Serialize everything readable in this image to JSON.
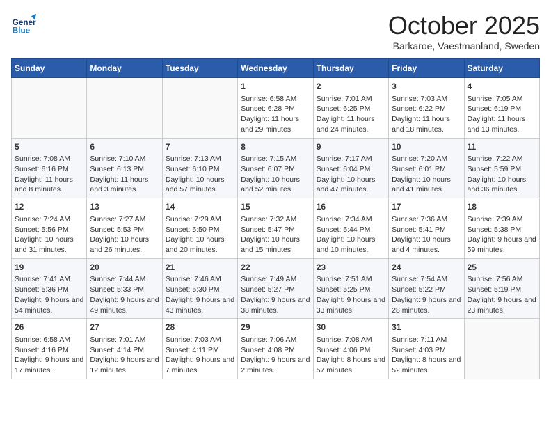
{
  "header": {
    "logo_general": "General",
    "logo_blue": "Blue",
    "month": "October 2025",
    "location": "Barkaroe, Vaestmanland, Sweden"
  },
  "days_of_week": [
    "Sunday",
    "Monday",
    "Tuesday",
    "Wednesday",
    "Thursday",
    "Friday",
    "Saturday"
  ],
  "weeks": [
    [
      {
        "day": "",
        "info": ""
      },
      {
        "day": "",
        "info": ""
      },
      {
        "day": "",
        "info": ""
      },
      {
        "day": "1",
        "info": "Sunrise: 6:58 AM\nSunset: 6:28 PM\nDaylight: 11 hours and 29 minutes."
      },
      {
        "day": "2",
        "info": "Sunrise: 7:01 AM\nSunset: 6:25 PM\nDaylight: 11 hours and 24 minutes."
      },
      {
        "day": "3",
        "info": "Sunrise: 7:03 AM\nSunset: 6:22 PM\nDaylight: 11 hours and 18 minutes."
      },
      {
        "day": "4",
        "info": "Sunrise: 7:05 AM\nSunset: 6:19 PM\nDaylight: 11 hours and 13 minutes."
      }
    ],
    [
      {
        "day": "5",
        "info": "Sunrise: 7:08 AM\nSunset: 6:16 PM\nDaylight: 11 hours and 8 minutes."
      },
      {
        "day": "6",
        "info": "Sunrise: 7:10 AM\nSunset: 6:13 PM\nDaylight: 11 hours and 3 minutes."
      },
      {
        "day": "7",
        "info": "Sunrise: 7:13 AM\nSunset: 6:10 PM\nDaylight: 10 hours and 57 minutes."
      },
      {
        "day": "8",
        "info": "Sunrise: 7:15 AM\nSunset: 6:07 PM\nDaylight: 10 hours and 52 minutes."
      },
      {
        "day": "9",
        "info": "Sunrise: 7:17 AM\nSunset: 6:04 PM\nDaylight: 10 hours and 47 minutes."
      },
      {
        "day": "10",
        "info": "Sunrise: 7:20 AM\nSunset: 6:01 PM\nDaylight: 10 hours and 41 minutes."
      },
      {
        "day": "11",
        "info": "Sunrise: 7:22 AM\nSunset: 5:59 PM\nDaylight: 10 hours and 36 minutes."
      }
    ],
    [
      {
        "day": "12",
        "info": "Sunrise: 7:24 AM\nSunset: 5:56 PM\nDaylight: 10 hours and 31 minutes."
      },
      {
        "day": "13",
        "info": "Sunrise: 7:27 AM\nSunset: 5:53 PM\nDaylight: 10 hours and 26 minutes."
      },
      {
        "day": "14",
        "info": "Sunrise: 7:29 AM\nSunset: 5:50 PM\nDaylight: 10 hours and 20 minutes."
      },
      {
        "day": "15",
        "info": "Sunrise: 7:32 AM\nSunset: 5:47 PM\nDaylight: 10 hours and 15 minutes."
      },
      {
        "day": "16",
        "info": "Sunrise: 7:34 AM\nSunset: 5:44 PM\nDaylight: 10 hours and 10 minutes."
      },
      {
        "day": "17",
        "info": "Sunrise: 7:36 AM\nSunset: 5:41 PM\nDaylight: 10 hours and 4 minutes."
      },
      {
        "day": "18",
        "info": "Sunrise: 7:39 AM\nSunset: 5:38 PM\nDaylight: 9 hours and 59 minutes."
      }
    ],
    [
      {
        "day": "19",
        "info": "Sunrise: 7:41 AM\nSunset: 5:36 PM\nDaylight: 9 hours and 54 minutes."
      },
      {
        "day": "20",
        "info": "Sunrise: 7:44 AM\nSunset: 5:33 PM\nDaylight: 9 hours and 49 minutes."
      },
      {
        "day": "21",
        "info": "Sunrise: 7:46 AM\nSunset: 5:30 PM\nDaylight: 9 hours and 43 minutes."
      },
      {
        "day": "22",
        "info": "Sunrise: 7:49 AM\nSunset: 5:27 PM\nDaylight: 9 hours and 38 minutes."
      },
      {
        "day": "23",
        "info": "Sunrise: 7:51 AM\nSunset: 5:25 PM\nDaylight: 9 hours and 33 minutes."
      },
      {
        "day": "24",
        "info": "Sunrise: 7:54 AM\nSunset: 5:22 PM\nDaylight: 9 hours and 28 minutes."
      },
      {
        "day": "25",
        "info": "Sunrise: 7:56 AM\nSunset: 5:19 PM\nDaylight: 9 hours and 23 minutes."
      }
    ],
    [
      {
        "day": "26",
        "info": "Sunrise: 6:58 AM\nSunset: 4:16 PM\nDaylight: 9 hours and 17 minutes."
      },
      {
        "day": "27",
        "info": "Sunrise: 7:01 AM\nSunset: 4:14 PM\nDaylight: 9 hours and 12 minutes."
      },
      {
        "day": "28",
        "info": "Sunrise: 7:03 AM\nSunset: 4:11 PM\nDaylight: 9 hours and 7 minutes."
      },
      {
        "day": "29",
        "info": "Sunrise: 7:06 AM\nSunset: 4:08 PM\nDaylight: 9 hours and 2 minutes."
      },
      {
        "day": "30",
        "info": "Sunrise: 7:08 AM\nSunset: 4:06 PM\nDaylight: 8 hours and 57 minutes."
      },
      {
        "day": "31",
        "info": "Sunrise: 7:11 AM\nSunset: 4:03 PM\nDaylight: 8 hours and 52 minutes."
      },
      {
        "day": "",
        "info": ""
      }
    ]
  ]
}
